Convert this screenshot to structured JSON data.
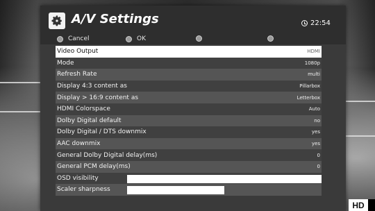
{
  "header": {
    "title": "A/V Settings",
    "clock": "22:54",
    "icon": "gear-icon"
  },
  "buttons": {
    "cancel_label": "Cancel",
    "ok_label": "OK"
  },
  "settings": [
    {
      "label": "Video Output",
      "value": "HDMI"
    },
    {
      "label": "Mode",
      "value": "1080p"
    },
    {
      "label": "Refresh Rate",
      "value": "multi"
    },
    {
      "label": "Display 4:3 content as",
      "value": "Pillarbox"
    },
    {
      "label": "Display > 16:9 content as",
      "value": "Letterbox"
    },
    {
      "label": "HDMI Colorspace",
      "value": "Auto"
    },
    {
      "label": "Dolby Digital default",
      "value": "no"
    },
    {
      "label": "Dolby Digital / DTS downmix",
      "value": "yes"
    },
    {
      "label": "AAC downmix",
      "value": "yes"
    },
    {
      "label": "General Dolby Digital delay(ms)",
      "value": "0"
    },
    {
      "label": "General PCM delay(ms)",
      "value": "0"
    },
    {
      "label": "OSD visibility",
      "level": 1.0
    },
    {
      "label": "Scaler sharpness",
      "level": 0.5
    }
  ],
  "badge": {
    "hd_label": "HD"
  }
}
